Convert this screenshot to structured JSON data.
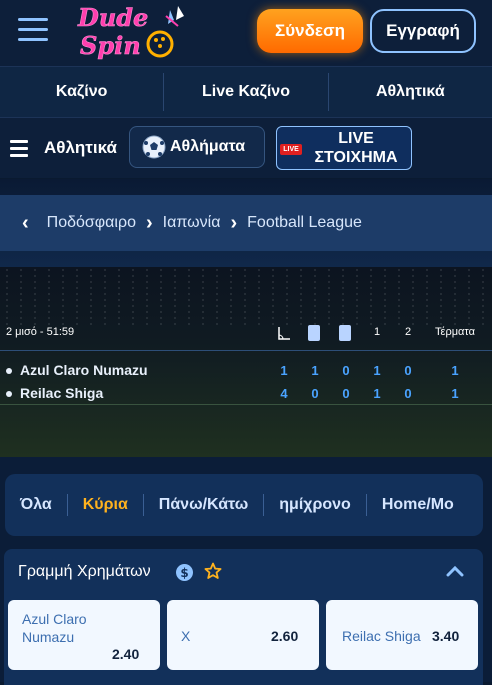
{
  "header": {
    "logo_text_line1": "Dude",
    "logo_text_line2": "Spin",
    "login_label": "Σύνδεση",
    "register_label": "Εγγραφή"
  },
  "main_nav": {
    "items": [
      {
        "label": "Καζίνο"
      },
      {
        "label": "Live Καζίνο"
      },
      {
        "label": "Αθλητικά"
      }
    ]
  },
  "sub_nav": {
    "title": "Αθλητικά",
    "sports_label": "Αθλήματα",
    "live_badge": "LIVE",
    "live_line1": "LIVE",
    "live_line2": "ΣΤΟΙΧΗΜΑ"
  },
  "breadcrumb": {
    "items": [
      "Ποδόσφαιρο",
      "Ιαπωνία",
      "Football League"
    ]
  },
  "scoreboard": {
    "period": "2 μισό - 51:59",
    "columns": [
      "1",
      "2",
      "Τέρματα"
    ],
    "teams": [
      {
        "name": "Azul Claro Numazu",
        "stats": [
          "1",
          "1",
          "0",
          "1",
          "0"
        ],
        "goals": "1"
      },
      {
        "name": "Reilac Shiga",
        "stats": [
          "4",
          "0",
          "0",
          "1",
          "0"
        ],
        "goals": "1"
      }
    ]
  },
  "market_tabs": {
    "items": [
      "Όλα",
      "Κύρια",
      "Πάνω/Κάτω",
      "ημίχρονο",
      "Home/Mo"
    ],
    "active": "Κύρια"
  },
  "market": {
    "title": "Γραμμή Χρημάτων",
    "odds": [
      {
        "label": "Azul Claro Numazu",
        "value": "2.40"
      },
      {
        "label": "X",
        "value": "2.60"
      },
      {
        "label": "Reilac Shiga",
        "value": "3.40"
      }
    ]
  },
  "colors": {
    "accent_orange": "#ff8a00",
    "active_tab": "#ffb21e",
    "score_blue": "#4aa3ff",
    "background": "#0a1a30"
  }
}
